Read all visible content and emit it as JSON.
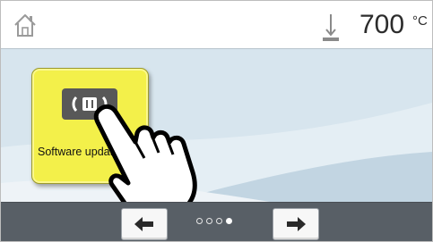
{
  "header": {
    "home_icon": "home-icon",
    "temperature_icon": "thermometer-icon",
    "temperature_value": "700",
    "temperature_unit": "°C"
  },
  "tiles": [
    {
      "label": "Software update",
      "icon": "software-update-icon",
      "background": "#f3f04a"
    }
  ],
  "pagination": {
    "prev_icon": "arrow-left-icon",
    "next_icon": "arrow-right-icon",
    "pages": 4,
    "active_page": 4
  },
  "overlay": {
    "icon": "pointing-hand-icon"
  },
  "colors": {
    "main_background": "#d7e5ee",
    "bottom_bar": "#585f66",
    "tile": "#f3f04a"
  }
}
